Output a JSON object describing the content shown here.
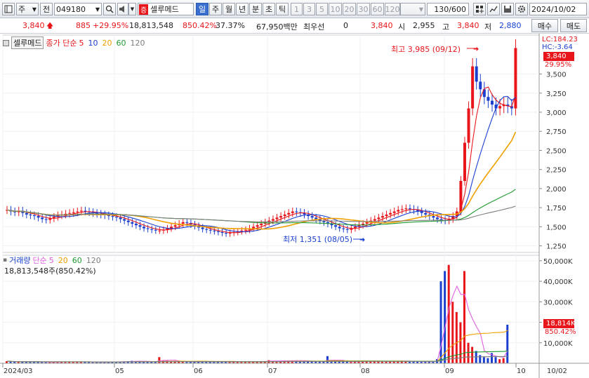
{
  "toolbar": {
    "market_select": "주",
    "prev_label": "전",
    "code": "049180",
    "stock_badge": "증",
    "stock_name": "셀루메드",
    "periods": [
      "일",
      "주",
      "월",
      "년",
      "분",
      "초",
      "틱"
    ],
    "active_period": "일",
    "intervals": [
      "1",
      "3",
      "5",
      "10",
      "20",
      "30",
      "60",
      "120"
    ],
    "count": "130/600",
    "date": "2024/10/02",
    "icons": [
      "chart-menu-icon",
      "search-icon",
      "speaker-icon",
      "dropdown-icon",
      "grid-plus-icon",
      "save-disk-icon",
      "settings-gear-icon",
      "calendar-icon"
    ]
  },
  "quote": {
    "price": "3,840",
    "change": "885",
    "change_pct": "+29.95%",
    "volume": "18,813,548",
    "volume_ratio": "850.42%",
    "turnover": "37.37%",
    "trade_amount": "67,950백만",
    "best_quote_label": "최우선",
    "best_quote_value": "0",
    "bid_price": "3,840",
    "open_label": "시",
    "open": "2,955",
    "high_label": "고",
    "high": "3,840",
    "low_label": "저",
    "low": "2,880",
    "buy_label": "매수",
    "sell_label": "매도"
  },
  "price_panel": {
    "legend_name": "셀루메드",
    "legend_ma_prefix": "종가 단순",
    "ma_periods": [
      "5",
      "10",
      "20",
      "60",
      "120"
    ],
    "ma_colors": [
      "#e8161b",
      "#1a3fcf",
      "#f0a000",
      "#1f9a30",
      "#7d7d7d"
    ],
    "lc": "LC:184.23",
    "hc": "HC:-3.64",
    "price_tag": "3,840",
    "pct_tag": "29.95%",
    "high_note": "최고 3,985 (09/12)",
    "low_note": "최저 1,351 (08/05)",
    "y_ticks": [
      "3,500",
      "3,250",
      "3,000",
      "2,750",
      "2,500",
      "2,250",
      "2,000",
      "1,750",
      "1,500",
      "1,250"
    ]
  },
  "volume_panel": {
    "legend_name": "거래량",
    "legend_ma_prefix": "단순",
    "ma_periods": [
      "5",
      "20",
      "60",
      "120"
    ],
    "ma_colors": [
      "#e060e0",
      "#f0a000",
      "#1f9a30",
      "#7d7d7d"
    ],
    "info": "18,813,548주(850.42%)",
    "vol_tag": "18,814K",
    "pct_tag": "850.42%",
    "y_ticks": [
      "50,000K",
      "40,000K",
      "30,000K",
      "20,000K",
      "10,000K"
    ]
  },
  "x_axis": {
    "labels": [
      "2024/03",
      "05",
      "06",
      "07",
      "08",
      "09",
      "10",
      "10/02"
    ]
  },
  "chart_data": {
    "type": "candlestick",
    "x_labels": [
      "2024/03",
      "05",
      "06",
      "07",
      "08",
      "09",
      "10"
    ],
    "price_ylim": [
      1200,
      3900
    ],
    "volume_ylim": [
      0,
      52000
    ],
    "closes": [
      1720,
      1700,
      1690,
      1710,
      1680,
      1660,
      1650,
      1640,
      1620,
      1600,
      1590,
      1610,
      1630,
      1650,
      1660,
      1670,
      1680,
      1690,
      1700,
      1710,
      1700,
      1690,
      1680,
      1670,
      1660,
      1650,
      1640,
      1630,
      1620,
      1600,
      1580,
      1560,
      1540,
      1520,
      1500,
      1480,
      1470,
      1460,
      1450,
      1450,
      1460,
      1480,
      1500,
      1520,
      1540,
      1560,
      1550,
      1530,
      1510,
      1490,
      1470,
      1460,
      1450,
      1440,
      1430,
      1420,
      1410,
      1420,
      1430,
      1440,
      1450,
      1460,
      1480,
      1500,
      1520,
      1540,
      1560,
      1580,
      1600,
      1620,
      1640,
      1660,
      1680,
      1700,
      1690,
      1680,
      1660,
      1640,
      1620,
      1600,
      1580,
      1560,
      1540,
      1520,
      1500,
      1480,
      1470,
      1460,
      1480,
      1500,
      1520,
      1540,
      1560,
      1580,
      1600,
      1620,
      1640,
      1660,
      1680,
      1700,
      1720,
      1730,
      1740,
      1730,
      1720,
      1700,
      1680,
      1660,
      1640,
      1620,
      1600,
      1590,
      1580,
      1600,
      1640,
      1700,
      2100,
      2600,
      3050,
      3600,
      3400,
      3300,
      3200,
      3150,
      3100,
      3050,
      3080,
      3100,
      3080,
      3050,
      3840
    ],
    "volume_k": [
      1000,
      800,
      700,
      900,
      600,
      700,
      800,
      700,
      600,
      500,
      500,
      600,
      600,
      700,
      800,
      700,
      600,
      600,
      700,
      800,
      700,
      600,
      500,
      500,
      600,
      700,
      800,
      700,
      600,
      700,
      900,
      1000,
      1200,
      1000,
      900,
      800,
      700,
      700,
      800,
      3000,
      1500,
      1200,
      1000,
      900,
      800,
      700,
      600,
      600,
      700,
      800,
      900,
      800,
      700,
      600,
      600,
      700,
      800,
      900,
      800,
      700,
      600,
      700,
      800,
      900,
      1000,
      900,
      800,
      1500,
      1200,
      1000,
      1100,
      1200,
      1300,
      1400,
      1300,
      1200,
      1100,
      1000,
      900,
      800,
      900,
      1000,
      3500,
      1200,
      900,
      800,
      700,
      700,
      800,
      900,
      1000,
      1100,
      1200,
      1100,
      1000,
      900,
      800,
      900,
      1000,
      1100,
      1200,
      1100,
      1000,
      900,
      800,
      700,
      700,
      800,
      900,
      1000,
      2000,
      40000,
      45000,
      48000,
      30000,
      25000,
      20000,
      45000,
      10000,
      8000,
      6000,
      4000,
      3000,
      2500,
      5000,
      3000,
      2000,
      2500,
      18814
    ]
  }
}
